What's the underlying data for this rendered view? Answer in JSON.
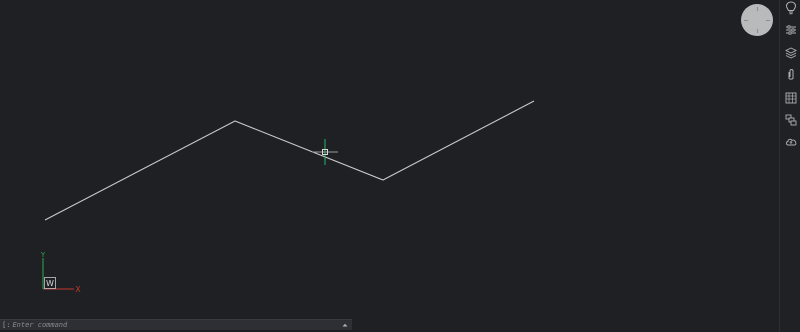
{
  "ucs": {
    "y_label": "Y",
    "x_label": "X",
    "w_label": "W"
  },
  "command": {
    "prefix": "[:",
    "placeholder": "Enter command",
    "history_icon": "caret-up-icon"
  },
  "right_toolbar": {
    "tools": [
      {
        "name": "lightbulb-icon"
      },
      {
        "name": "properties-sliders-icon"
      },
      {
        "name": "layers-icon"
      },
      {
        "name": "attach-paperclip-icon"
      },
      {
        "name": "blocks-icon"
      },
      {
        "name": "xref-icon"
      },
      {
        "name": "cloud-icon"
      }
    ]
  },
  "colors": {
    "background": "#1f2024",
    "polyline": "#c8c8c8",
    "crosshair_vertical": "#26b36b",
    "crosshair_horizontal": "#9a9a9a",
    "ucs_y_axis": "#2fa84f",
    "ucs_x_axis": "#c0392b",
    "viewcube": "#b9babc"
  }
}
